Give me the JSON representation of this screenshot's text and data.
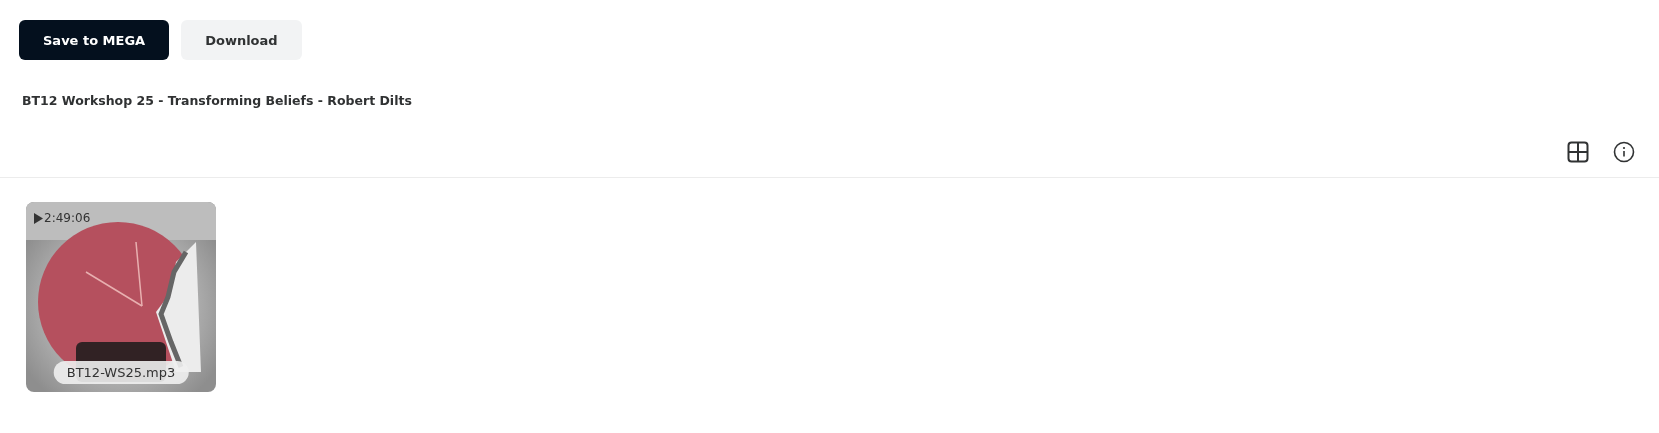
{
  "toolbar": {
    "buttons": [
      {
        "label": "Save to MEGA",
        "kind": "primary"
      },
      {
        "label": "Download",
        "kind": "secondary"
      }
    ]
  },
  "folder_title": "BT12 Workshop 25 - Transforming Beliefs - Robert Dilts",
  "files": [
    {
      "name": "BT12-WS25.mp3",
      "duration": "2:49:06",
      "kind": "picture"
    }
  ]
}
